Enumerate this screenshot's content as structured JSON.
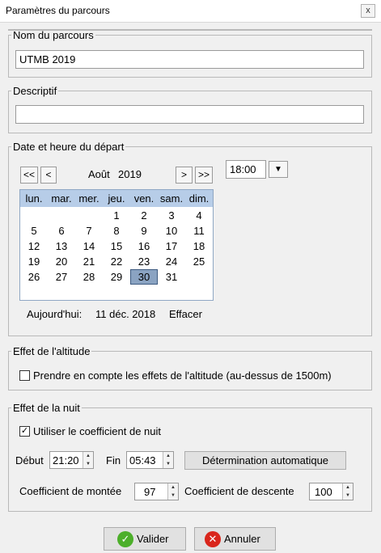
{
  "window": {
    "title": "Paramètres du parcours",
    "close_label": "x"
  },
  "nom": {
    "legend": "Nom du parcours",
    "value": "UTMB 2019"
  },
  "descriptif": {
    "legend": "Descriptif",
    "value": ""
  },
  "depart": {
    "legend": "Date et heure du départ",
    "nav": {
      "prev_year": "<<",
      "prev_month": "<",
      "next_month": ">",
      "next_year": ">>"
    },
    "month": "Août",
    "year": "2019",
    "time": "18:00",
    "time_dropdown": "▼",
    "weekdays": [
      "lun.",
      "mar.",
      "mer.",
      "jeu.",
      "ven.",
      "sam.",
      "dim."
    ],
    "weeks": [
      [
        "",
        "",
        "",
        "1",
        "2",
        "3",
        "4"
      ],
      [
        "5",
        "6",
        "7",
        "8",
        "9",
        "10",
        "11"
      ],
      [
        "12",
        "13",
        "14",
        "15",
        "16",
        "17",
        "18"
      ],
      [
        "19",
        "20",
        "21",
        "22",
        "23",
        "24",
        "25"
      ],
      [
        "26",
        "27",
        "28",
        "29",
        "30",
        "31",
        ""
      ]
    ],
    "selected_day": "30",
    "today_label": "Aujourd'hui:",
    "today_value": "11 déc. 2018",
    "clear_label": "Effacer"
  },
  "altitude": {
    "legend": "Effet de l'altitude",
    "checkbox_label": "Prendre en compte les effets de l'altitude (au-dessus de 1500m)",
    "checked": false
  },
  "nuit": {
    "legend": "Effet de la nuit",
    "checkbox_label": "Utiliser le coefficient de nuit",
    "checked": true,
    "debut_label": "Début",
    "debut_value": "21:20",
    "fin_label": "Fin",
    "fin_value": "05:43",
    "auto_button": "Détermination automatique",
    "montee_label": "Coefficient de montée",
    "montee_value": "97",
    "descente_label": "Coefficient de descente",
    "descente_value": "100"
  },
  "footer": {
    "ok_label": "Valider",
    "cancel_label": "Annuler"
  },
  "colors": {
    "calendar_header": "#b7cde8",
    "selected_day": "#8aa3c2",
    "ok_icon": "#4caf2a",
    "cancel_icon": "#d9261c"
  }
}
